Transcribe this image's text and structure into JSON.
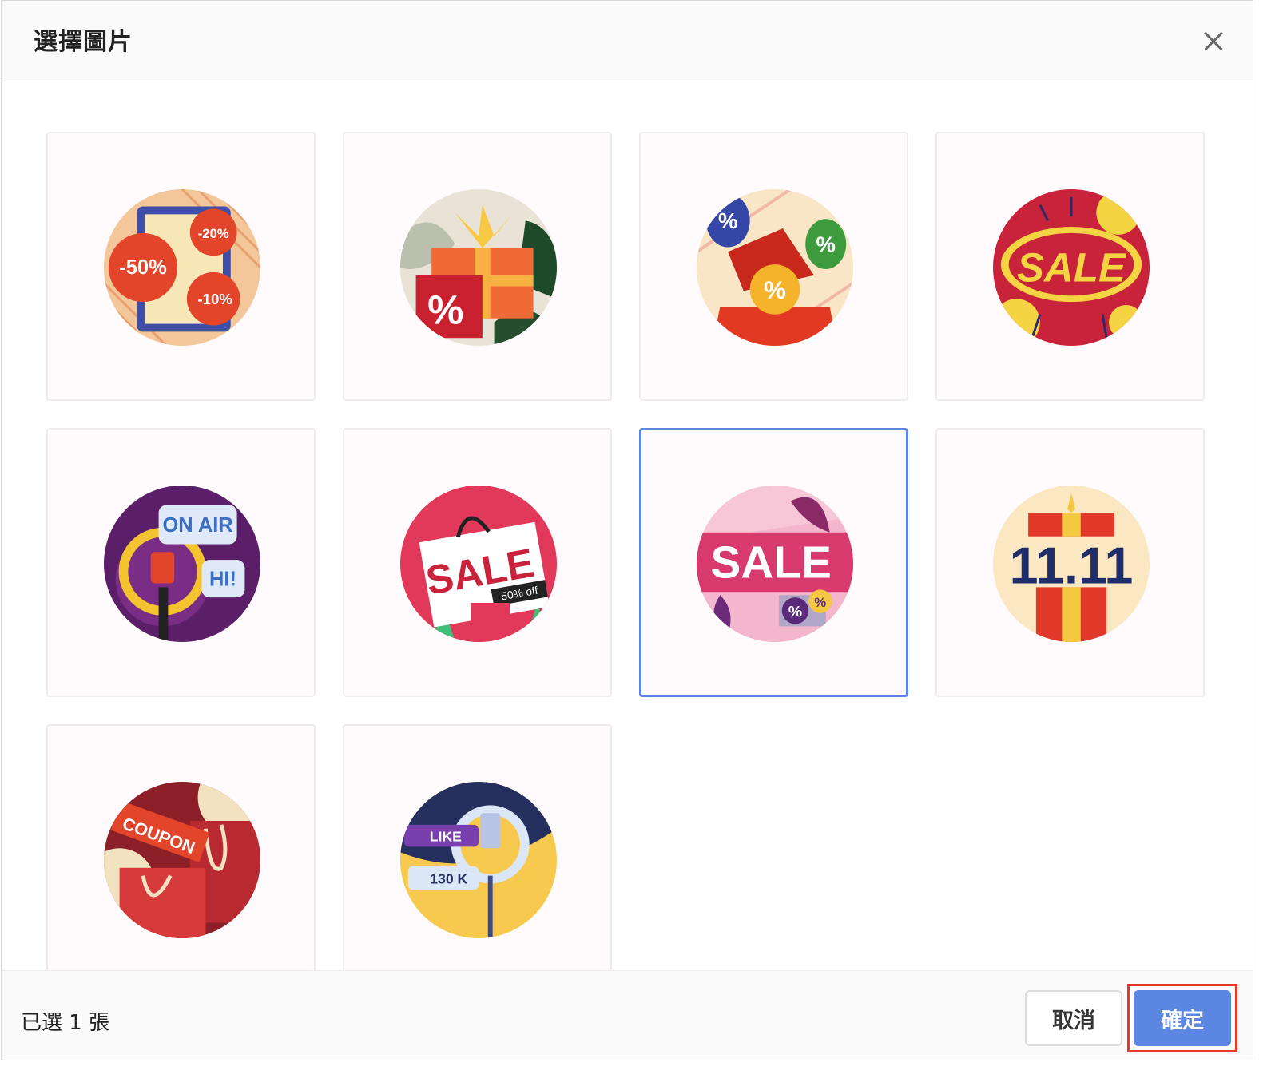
{
  "dialog": {
    "title": "選擇圖片",
    "close_icon": "close-icon"
  },
  "images": [
    {
      "name": "discount-bubbles",
      "labels": [
        "-50%",
        "-20%",
        "-10%"
      ],
      "selected": false
    },
    {
      "name": "gift-box-percent",
      "labels": [
        "%"
      ],
      "selected": false
    },
    {
      "name": "balloons-percent",
      "labels": [
        "%",
        "%",
        "%"
      ],
      "selected": false
    },
    {
      "name": "sale-burst",
      "labels": [
        "SALE"
      ],
      "selected": false
    },
    {
      "name": "on-air-microphone",
      "labels": [
        "ON AIR",
        "HI!"
      ],
      "selected": false
    },
    {
      "name": "sale-bag",
      "labels": [
        "SALE",
        "50% off"
      ],
      "selected": false
    },
    {
      "name": "sale-pink-cart",
      "labels": [
        "SALE",
        "%",
        "%"
      ],
      "selected": true
    },
    {
      "name": "double-eleven-gift",
      "labels": [
        "11.11"
      ],
      "selected": false
    },
    {
      "name": "coupon-bags",
      "labels": [
        "COUPON"
      ],
      "selected": false
    },
    {
      "name": "ring-light-like",
      "labels": [
        "LIKE",
        "130 K"
      ],
      "selected": false
    }
  ],
  "footer": {
    "selected_count": "已選 1 張",
    "cancel_label": "取消",
    "confirm_label": "確定"
  },
  "colors": {
    "accent": "#5b87e3",
    "highlight": "#e53b26"
  }
}
